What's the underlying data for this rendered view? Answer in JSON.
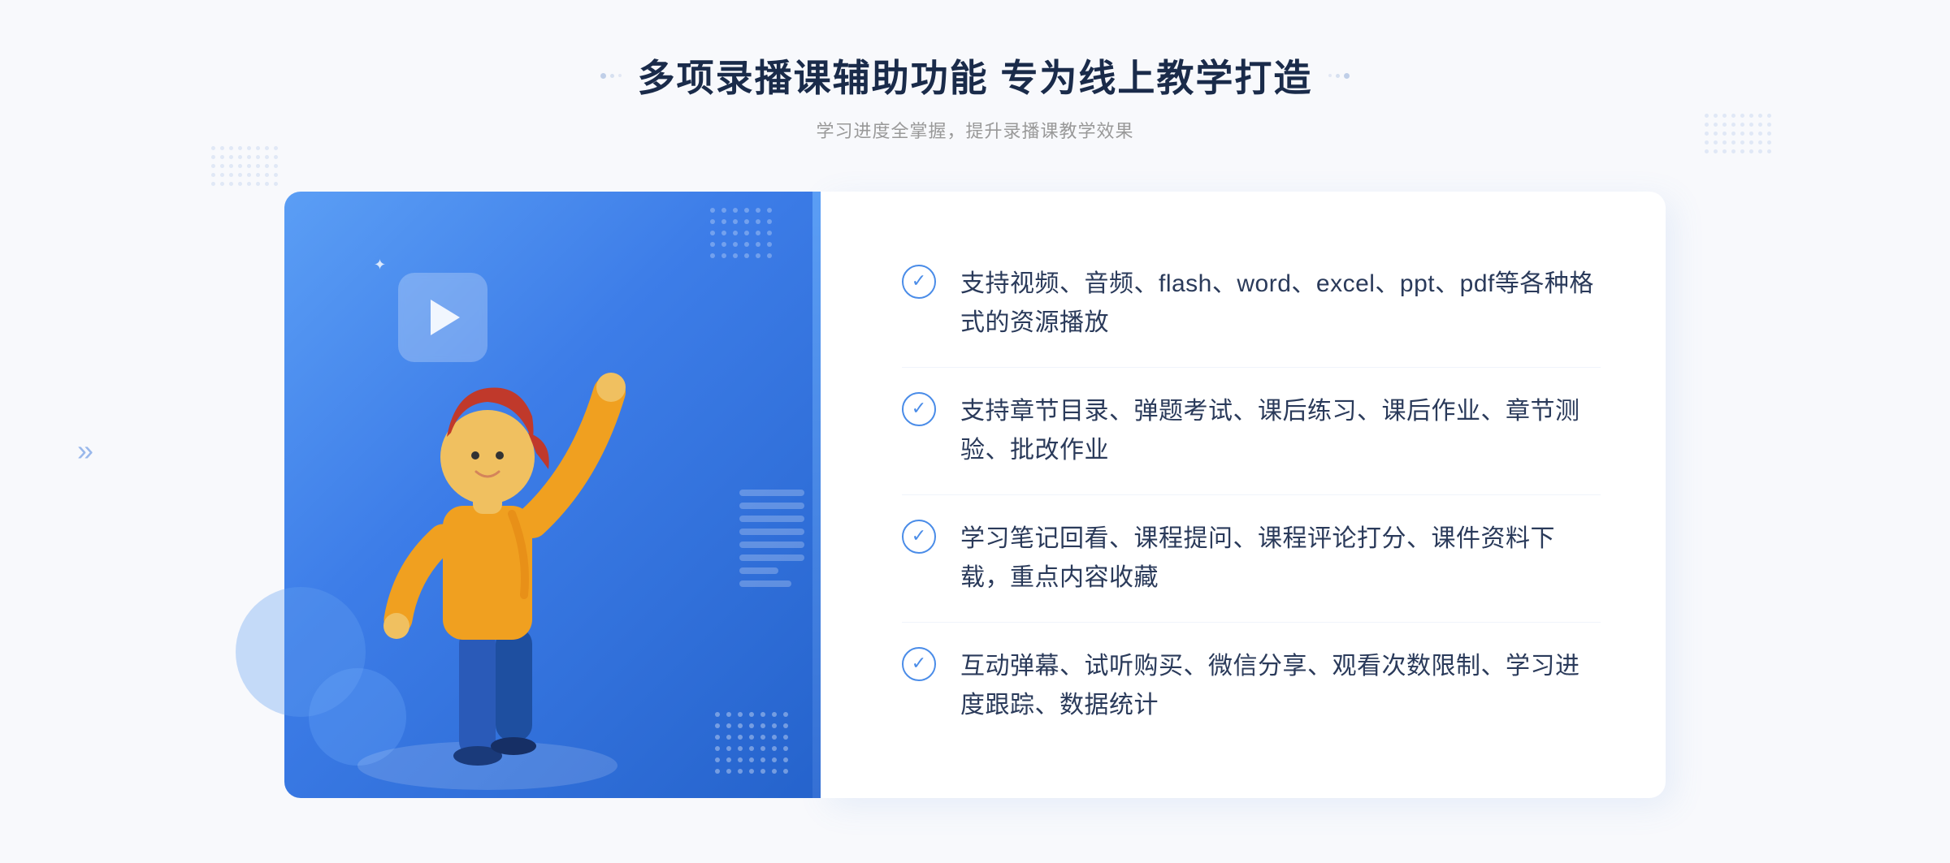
{
  "page": {
    "background": "#f8f9fc"
  },
  "header": {
    "title": "多项录播课辅助功能 专为线上教学打造",
    "subtitle": "学习进度全掌握，提升录播课教学效果",
    "left_dots_label": "decorative dots left",
    "right_dots_label": "decorative dots right"
  },
  "features": [
    {
      "id": 1,
      "text": "支持视频、音频、flash、word、excel、ppt、pdf等各种格式的资源播放"
    },
    {
      "id": 2,
      "text": "支持章节目录、弹题考试、课后练习、课后作业、章节测验、批改作业"
    },
    {
      "id": 3,
      "text": "学习笔记回看、课程提问、课程评论打分、课件资料下载，重点内容收藏"
    },
    {
      "id": 4,
      "text": "互动弹幕、试听购买、微信分享、观看次数限制、学习进度跟踪、数据统计"
    }
  ],
  "illustration": {
    "play_button_label": "播放",
    "sparkle_symbol": "✦"
  },
  "navigation": {
    "left_arrow": "»"
  }
}
